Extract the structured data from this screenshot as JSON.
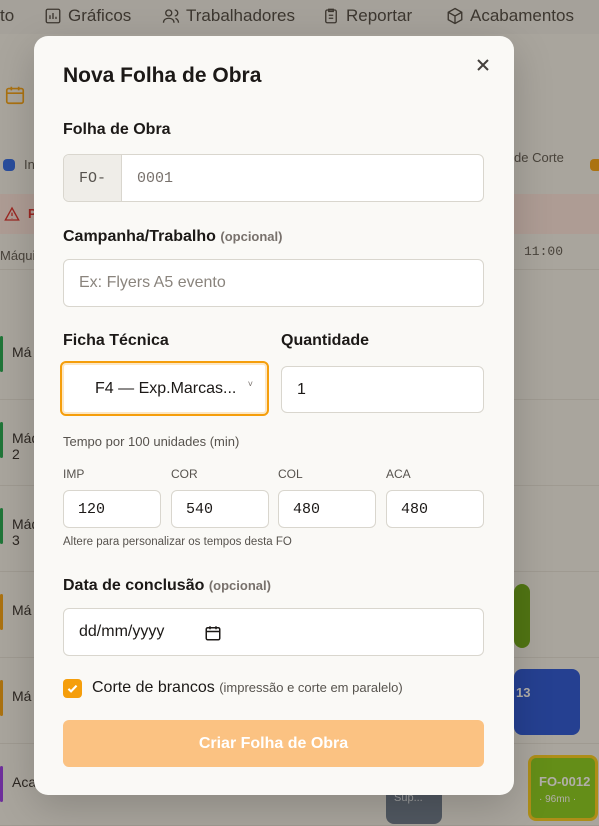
{
  "background": {
    "nav": {
      "items": [
        {
          "label": "to",
          "icon": "none"
        },
        {
          "label": "Gráficos",
          "icon": "bar-chart-icon"
        },
        {
          "label": "Trabalhadores",
          "icon": "users-icon"
        },
        {
          "label": "Reportar",
          "icon": "clipboard-icon"
        },
        {
          "label": "Acabamentos",
          "icon": "box-icon"
        }
      ]
    },
    "legend": {
      "left": "In",
      "right": "de Corte"
    },
    "alert_text": "P",
    "timeline": {
      "left": "Máqui",
      "time": "11:00"
    },
    "rows": [
      {
        "label": "Má"
      },
      {
        "label": "Máq 2"
      },
      {
        "label": "Máq 3"
      },
      {
        "label": "Má"
      },
      {
        "label": "Má"
      },
      {
        "label": "Aca"
      }
    ],
    "blocks": {
      "block_13": "13",
      "fo_0012": "FO-0012",
      "fo_0012_sub": "· 96mn ·",
      "gray_sub": "Sup..."
    }
  },
  "modal": {
    "title": "Nova Folha de Obra",
    "close_icon": "close-icon",
    "folha": {
      "label": "Folha de Obra",
      "prefix": "FO-",
      "placeholder": "0001"
    },
    "campanha": {
      "label": "Campanha/Trabalho",
      "optional": "(opcional)",
      "placeholder": "Ex: Flyers A5 evento"
    },
    "ficha": {
      "label": "Ficha Técnica",
      "selected": "F4 — Exp.Marcas...",
      "caret": "˅"
    },
    "quantidade": {
      "label": "Quantidade",
      "value": "1"
    },
    "tempo": {
      "label": "Tempo por 100 unidades (min)",
      "columns": [
        {
          "label": "IMP",
          "value": "120"
        },
        {
          "label": "COR",
          "value": "540"
        },
        {
          "label": "COL",
          "value": "480"
        },
        {
          "label": "ACA",
          "value": "480"
        }
      ],
      "hint": "Altere para personalizar os tempos desta FO"
    },
    "data": {
      "label": "Data de conclusão",
      "optional": "(opcional)",
      "placeholder": "dd/mm/yyyy"
    },
    "corte": {
      "label": "Corte de brancos",
      "sub": "(impressão e corte em paralelo)",
      "checked": true
    },
    "submit_label": "Criar Folha de Obra"
  },
  "colors": {
    "accent": "#f59e0b",
    "submit_disabled": "#fbc282",
    "overlay": "rgba(50,42,30,0.38)"
  }
}
